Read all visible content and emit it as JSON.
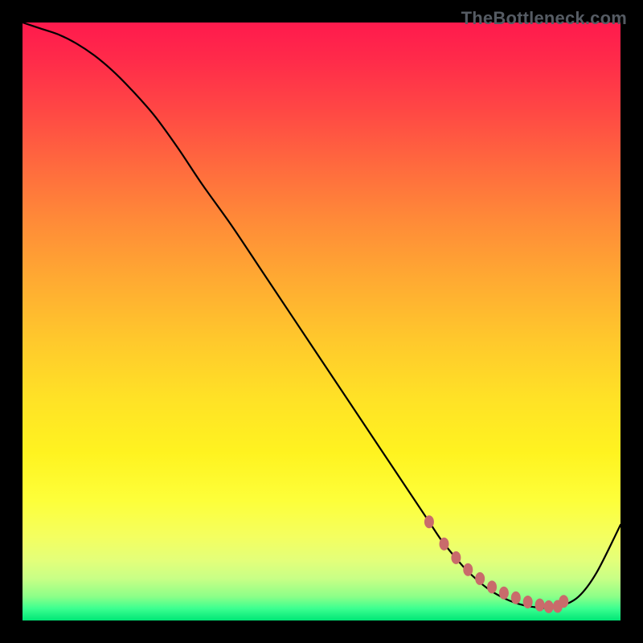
{
  "watermark": "TheBottleneck.com",
  "colors": {
    "curve": "#000000",
    "dot_fill": "#c96b6b",
    "background_black": "#000000"
  },
  "chart_data": {
    "type": "line",
    "title": "",
    "xlabel": "",
    "ylabel": "",
    "xlim": [
      0,
      100
    ],
    "ylim": [
      0,
      100
    ],
    "grid": false,
    "series": [
      {
        "name": "bottleneck-curve",
        "x": [
          0,
          3,
          6,
          9,
          12,
          15,
          18,
          22,
          26,
          30,
          35,
          40,
          45,
          50,
          55,
          60,
          65,
          68,
          70,
          72,
          74,
          76,
          78,
          80,
          82,
          84,
          86,
          88,
          90,
          93,
          96,
          100
        ],
        "y": [
          100,
          99,
          98,
          96.5,
          94.5,
          92,
          89,
          84.5,
          79,
          73,
          66,
          58.5,
          51,
          43.5,
          36,
          28.5,
          21,
          16.5,
          13.5,
          11,
          8.7,
          6.8,
          5.2,
          4,
          3.1,
          2.5,
          2.2,
          2.1,
          2.4,
          4,
          8,
          16
        ]
      }
    ],
    "highlight_points": {
      "name": "salmon-dots",
      "x": [
        68,
        70.5,
        72.5,
        74.5,
        76.5,
        78.5,
        80.5,
        82.5,
        84.5,
        86.5,
        88,
        89.5,
        90.5
      ],
      "y": [
        16.5,
        12.8,
        10.5,
        8.5,
        7,
        5.6,
        4.6,
        3.8,
        3.1,
        2.6,
        2.3,
        2.35,
        3.2
      ]
    }
  }
}
